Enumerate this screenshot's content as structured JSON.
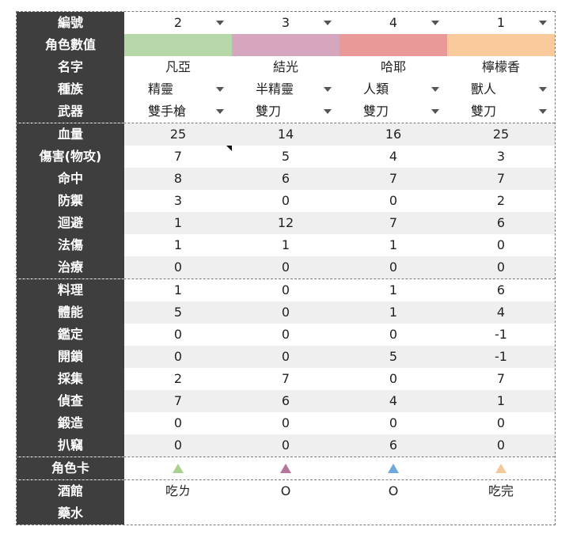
{
  "headers": {
    "id": "編號",
    "stats": "角色數值",
    "name": "名字",
    "race": "種族",
    "weapon": "武器",
    "hp": "血量",
    "dmg": "傷害(物攻)",
    "hit": "命中",
    "def": "防禦",
    "eva": "迴避",
    "mag": "法傷",
    "heal": "治療",
    "cook": "料理",
    "phys": "體能",
    "appraise": "鑑定",
    "unlock": "開鎖",
    "gather": "採集",
    "detect": "偵查",
    "forge": "鍛造",
    "steal": "扒竊",
    "card": "角色卡",
    "tavern": "酒館",
    "potion": "藥水"
  },
  "colors": {
    "swatch": [
      "#b6d7a8",
      "#d5a6bd",
      "#ea9999",
      "#f9cb9c"
    ],
    "card_triangle": [
      "#a9d08e",
      "#b4779a",
      "#6fa8dc",
      "#f4c89a"
    ]
  },
  "characters": [
    {
      "id": "2",
      "name": "凡亞",
      "race": "精靈",
      "weapon": "雙手槍",
      "hp": "25",
      "dmg": "7",
      "hit": "8",
      "def": "3",
      "eva": "1",
      "mag": "1",
      "heal": "0",
      "cook": "1",
      "phys": "5",
      "appraise": "0",
      "unlock": "0",
      "gather": "2",
      "detect": "7",
      "forge": "0",
      "steal": "0",
      "tavern": "吃ㄌ",
      "potion": ""
    },
    {
      "id": "3",
      "name": "結光",
      "race": "半精靈",
      "weapon": "雙刀",
      "hp": "14",
      "dmg": "5",
      "hit": "6",
      "def": "0",
      "eva": "12",
      "mag": "1",
      "heal": "0",
      "cook": "0",
      "phys": "0",
      "appraise": "0",
      "unlock": "0",
      "gather": "7",
      "detect": "6",
      "forge": "0",
      "steal": "0",
      "tavern": "O",
      "potion": ""
    },
    {
      "id": "4",
      "name": "哈耶",
      "race": "人類",
      "weapon": "雙刀",
      "hp": "16",
      "dmg": "4",
      "hit": "7",
      "def": "0",
      "eva": "7",
      "mag": "1",
      "heal": "0",
      "cook": "1",
      "phys": "1",
      "appraise": "0",
      "unlock": "5",
      "gather": "0",
      "detect": "4",
      "forge": "0",
      "steal": "6",
      "tavern": "O",
      "potion": ""
    },
    {
      "id": "1",
      "name": "檸檬香",
      "race": "獸人",
      "weapon": "雙刀",
      "hp": "25",
      "dmg": "3",
      "hit": "7",
      "def": "2",
      "eva": "6",
      "mag": "0",
      "heal": "0",
      "cook": "6",
      "phys": "4",
      "appraise": "-1",
      "unlock": "-1",
      "gather": "7",
      "detect": "1",
      "forge": "0",
      "steal": "0",
      "tavern": "吃完",
      "potion": ""
    }
  ]
}
